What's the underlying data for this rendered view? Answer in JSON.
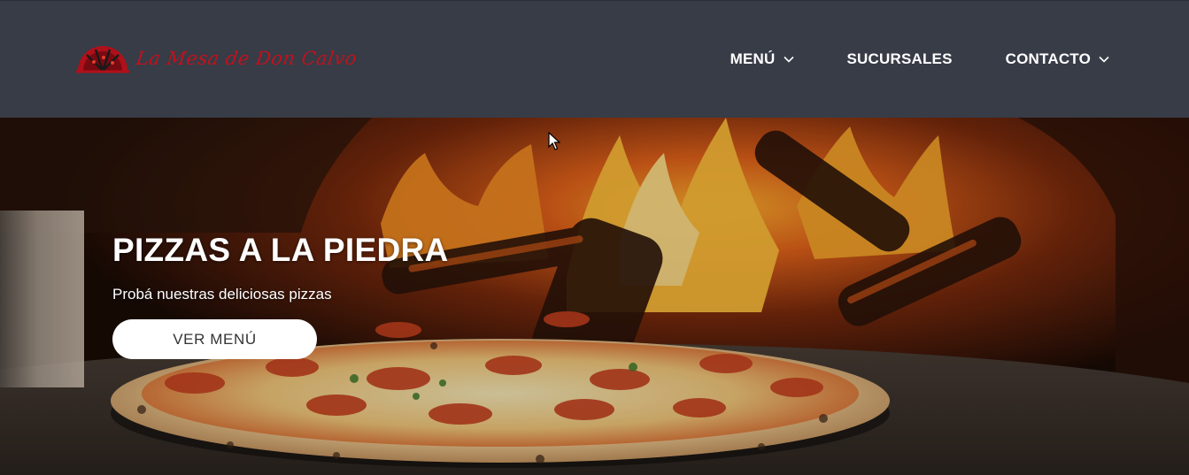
{
  "header": {
    "logo_text": "La Mesa de Don Calvo",
    "nav": [
      {
        "label": "MENÚ",
        "has_dropdown": true
      },
      {
        "label": "SUCURSALES",
        "has_dropdown": false
      },
      {
        "label": "CONTACTO",
        "has_dropdown": true
      }
    ]
  },
  "hero": {
    "title": "PIZZAS A LA PIEDRA",
    "subtitle": "Probá nuestras deliciosas pizzas",
    "button_label": "VER MENÚ"
  },
  "colors": {
    "header_bg": "#373c47",
    "logo_red": "#c0121d",
    "button_bg": "#ffffff",
    "text_light": "#ffffff"
  },
  "icons": {
    "logo": "pizza-slice-logo-icon",
    "dropdown": "chevron-down-icon",
    "cursor": "mouse-pointer-icon"
  }
}
